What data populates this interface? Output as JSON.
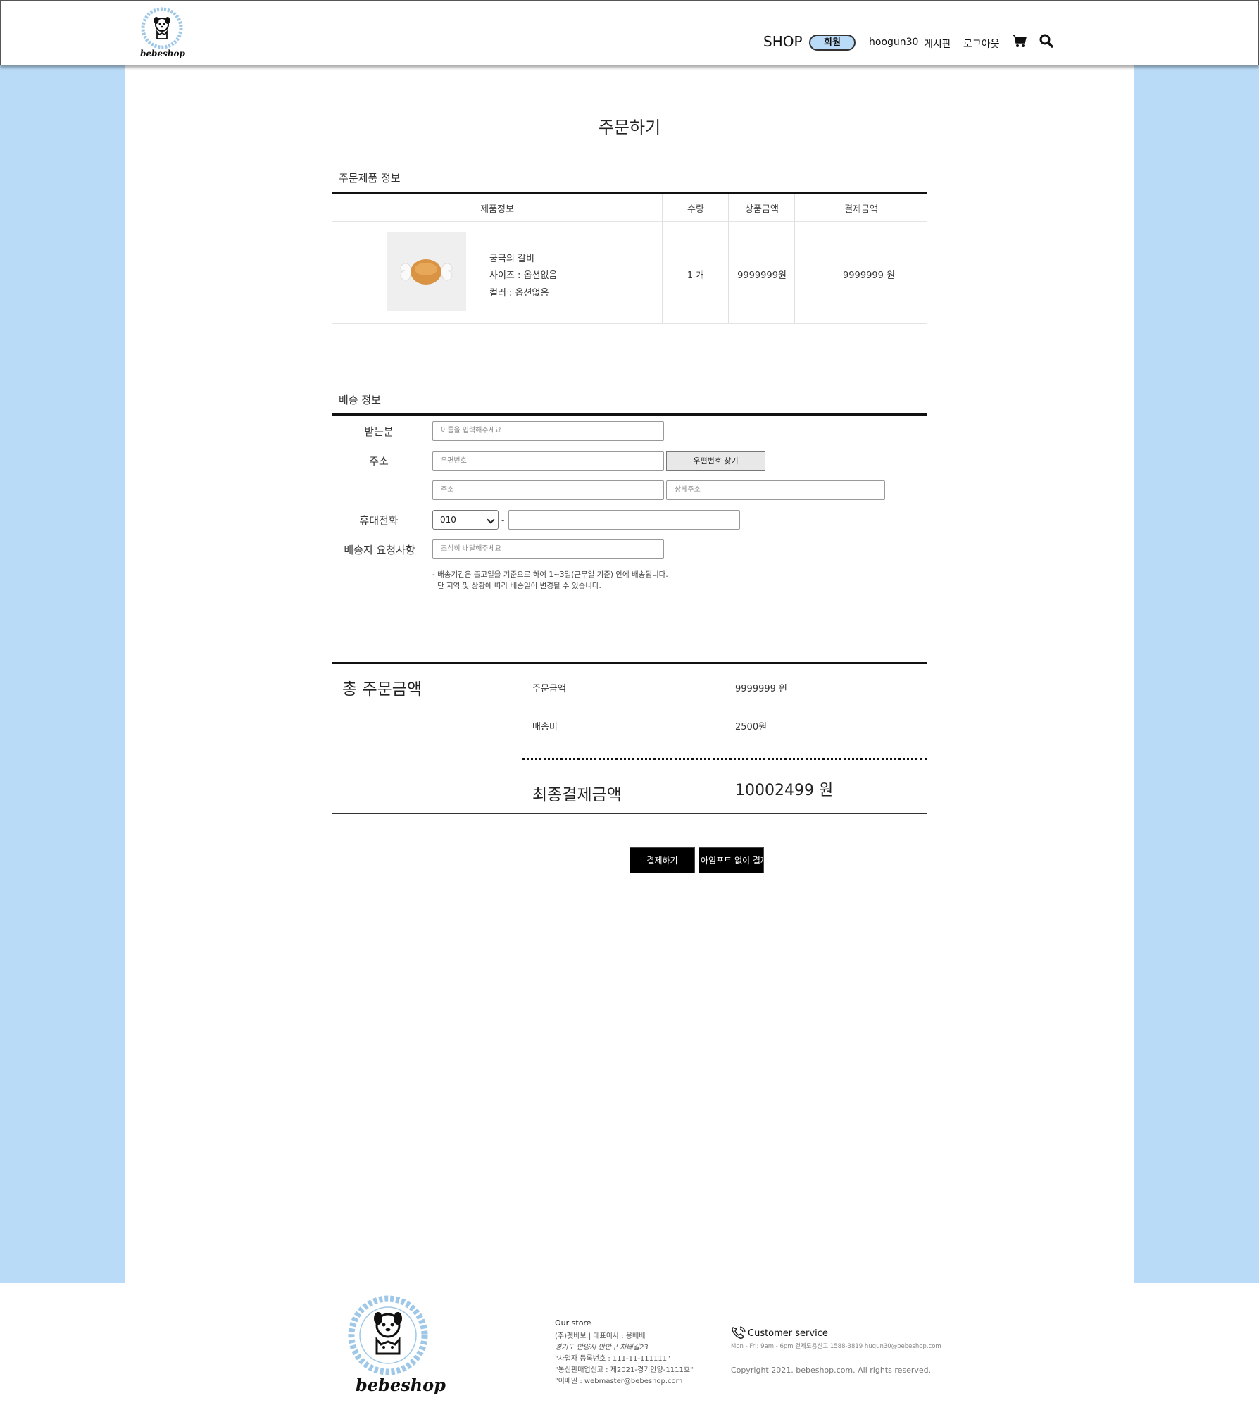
{
  "header": {
    "logo_text": "bebeshop",
    "nav": {
      "shop": "SHOP",
      "member": "회원",
      "user": "hoogun30",
      "board": "게시판",
      "logout": "로그아웃"
    }
  },
  "page": {
    "title": "주문하기"
  },
  "order_section": {
    "title": "주문제품 정보",
    "columns": [
      "제품정보",
      "수량",
      "상품금액",
      "결제금액"
    ],
    "item": {
      "name": "궁극의 갈비",
      "size": "사이즈 : 옵션없음",
      "color": "컬러 : 옵션없음",
      "qty": "1 개",
      "price": "9999999원",
      "pay": "9999999 원"
    }
  },
  "delivery": {
    "title": "배송 정보",
    "labels": {
      "recipient": "받는분",
      "address": "주소",
      "phone": "휴대전화",
      "request": "배송지 요청사항"
    },
    "placeholders": {
      "recipient": "이름을 입력해주세요",
      "zipcode": "우편번호",
      "address": "주소",
      "detail": "상세주소",
      "request": "조심히 배달해주세요"
    },
    "find_zip_button": "우편번호 찾기",
    "phone_prefix": "010",
    "dash": "-",
    "notes": [
      "- 배송기간은 출고일을 기준으로 하여 1~3일(근무일 기준) 안에 배송됩니다.",
      "단 지역 및 상황에 따라 배송일이 변경될 수 있습니다."
    ]
  },
  "summary": {
    "title": "총 주문금액",
    "order_label": "주문금액",
    "order_value": "9999999 원",
    "shipping_label": "배송비",
    "shipping_value": "2500원",
    "final_label": "최종결제금액",
    "final_value": "10002499 원"
  },
  "actions": {
    "pay": "결제하기",
    "pay_without_iamport": "아임포트 없이 결제"
  },
  "footer": {
    "logo_text": "bebeshop",
    "store_title": "Our store",
    "store_lines": [
      "(주)펫바보 | 대표이사 : 용베베",
      "경기도 안양시 만안구 차베길23",
      "\"사업자 등록번호 : 111-11-111111\"",
      "\"통신판매업신고 : 제2021-경기안양-1111호\"",
      "\"이메일 : webmaster@bebeshop.com"
    ],
    "cs_title": "Customer service",
    "cs_line": "Mon - Fri: 9am - 6pm 결제도용신고 1588-3819 hugun30@bebeshop.com",
    "copyright": "Copyright 2021. bebeshop.com. All rights reserved."
  },
  "colors": {
    "side_blue": "#b9dbf7",
    "button_black": "#000000"
  }
}
